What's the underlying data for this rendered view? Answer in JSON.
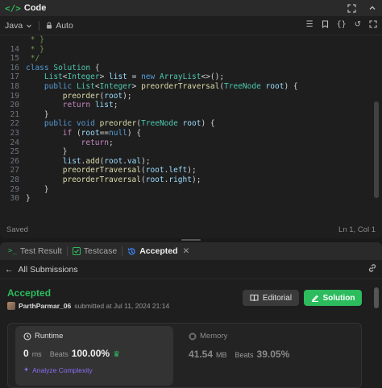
{
  "code_panel": {
    "title": "Code",
    "language": "Java",
    "mode": "Auto",
    "status": "Saved",
    "cursor": "Ln 1, Col 1"
  },
  "editor_lines": [
    {
      "n": "",
      "t": " * }"
    },
    {
      "n": "14",
      "t": " * }"
    },
    {
      "n": "15",
      "t": " */"
    },
    {
      "n": "16",
      "t": "class Solution {"
    },
    {
      "n": "17",
      "t": "    List<Integer> list = new ArrayList<>();"
    },
    {
      "n": "18",
      "t": "    public List<Integer> preorderTraversal(TreeNode root) {"
    },
    {
      "n": "19",
      "t": "        preorder(root);"
    },
    {
      "n": "20",
      "t": "        return list;"
    },
    {
      "n": "21",
      "t": "    }"
    },
    {
      "n": "22",
      "t": "    public void preorder(TreeNode root) {"
    },
    {
      "n": "23",
      "t": "        if (root==null) {"
    },
    {
      "n": "24",
      "t": "            return;"
    },
    {
      "n": "25",
      "t": "        }"
    },
    {
      "n": "26",
      "t": "        list.add(root.val);"
    },
    {
      "n": "27",
      "t": "        preorderTraversal(root.left);"
    },
    {
      "n": "28",
      "t": "        preorderTraversal(root.right);"
    },
    {
      "n": "29",
      "t": "    }"
    },
    {
      "n": "30",
      "t": "}"
    }
  ],
  "tabs": [
    {
      "label": "Test Result"
    },
    {
      "label": "Testcase"
    },
    {
      "label": "Accepted"
    }
  ],
  "result": {
    "back_label": "All Submissions",
    "status": "Accepted",
    "user": "ParthParmar_06",
    "submitted_text": "submitted at Jul 11, 2024 21:14",
    "editorial_label": "Editorial",
    "solution_label": "Solution",
    "runtime": {
      "label": "Runtime",
      "value": "0",
      "unit": "ms",
      "beats_label": "Beats",
      "beats": "100.00%",
      "analyze_label": "Analyze Complexity"
    },
    "memory": {
      "label": "Memory",
      "value": "41.54",
      "unit": "MB",
      "beats_label": "Beats",
      "beats": "39.05%"
    }
  },
  "colors": {
    "accent_green": "#2cbb5d",
    "analyze_purple": "#8b6ef5",
    "accepted_tab_icon": "#3b82f6"
  }
}
